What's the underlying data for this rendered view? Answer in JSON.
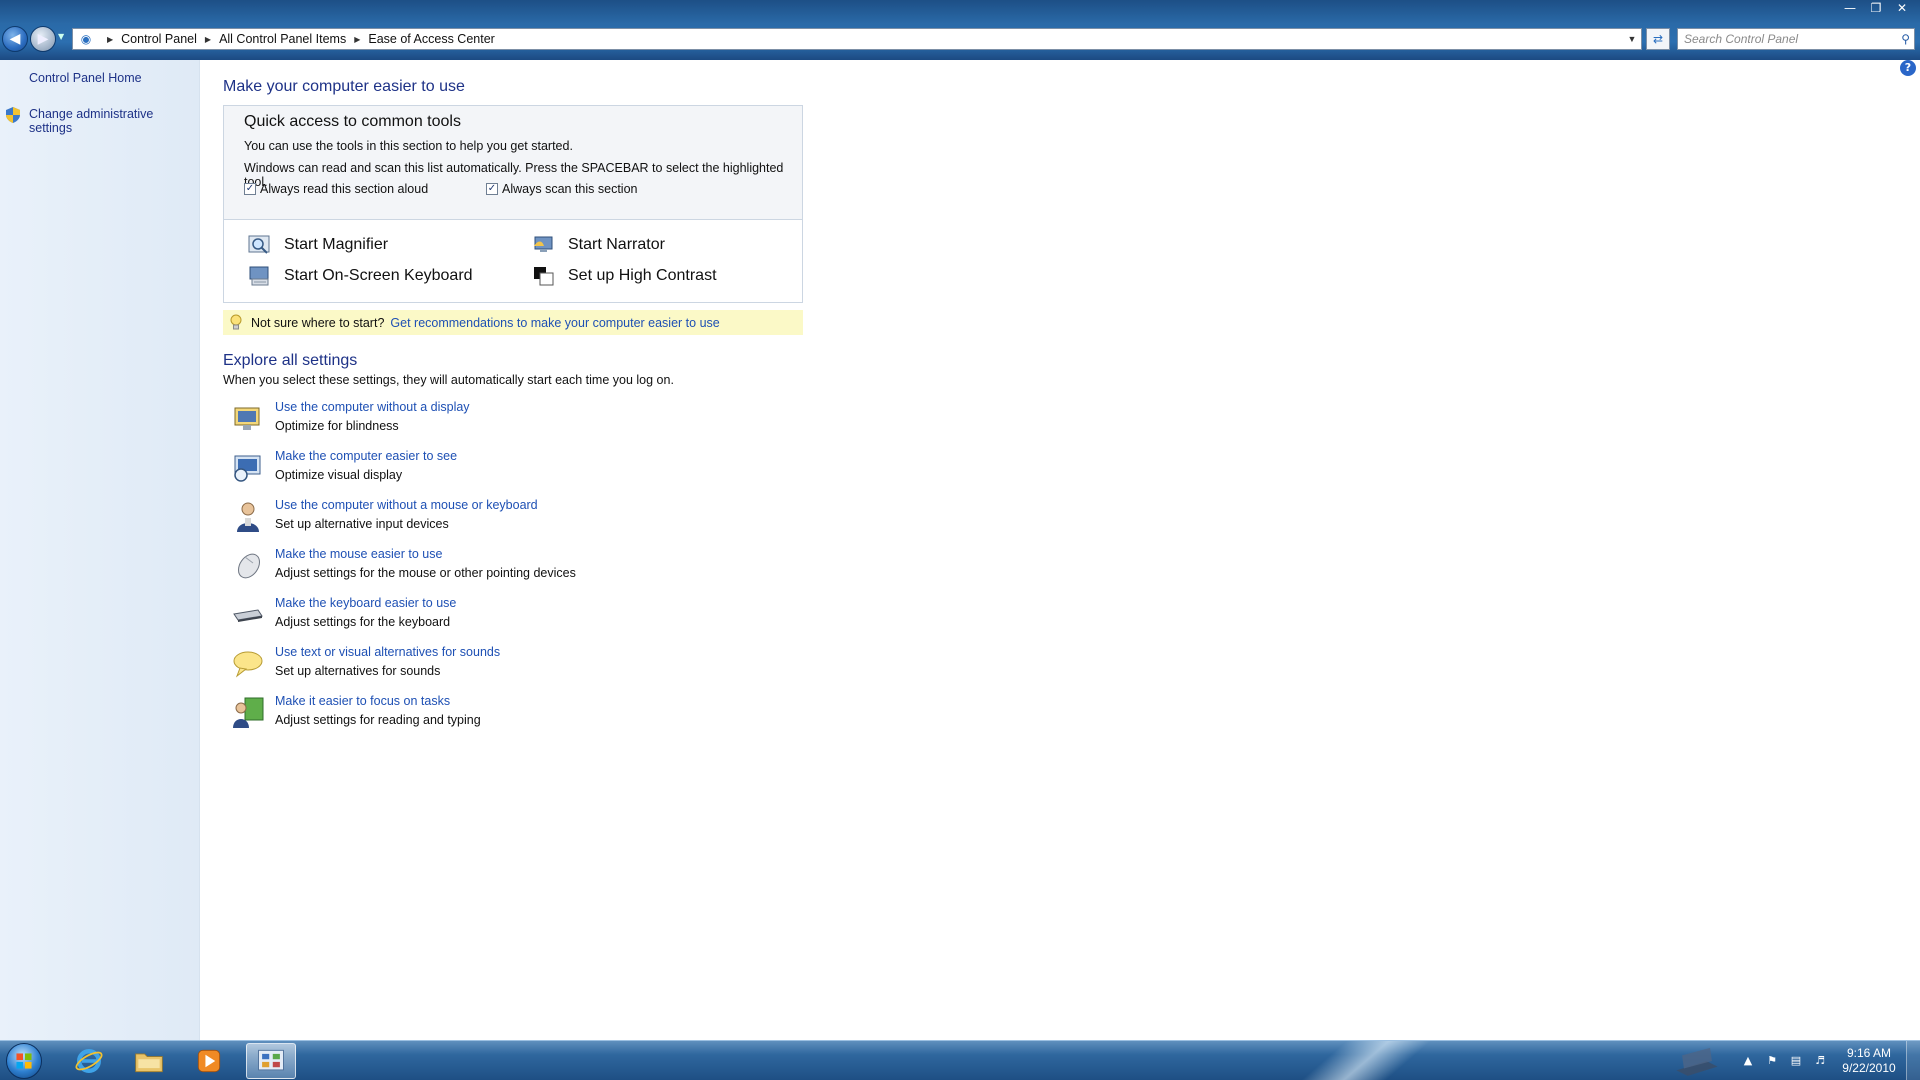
{
  "addressbar": {
    "crumbs": [
      "Control Panel",
      "All Control Panel Items",
      "Ease of Access Center"
    ],
    "search_placeholder": "Search Control Panel"
  },
  "sidebar": {
    "home": "Control Panel Home",
    "admin": "Change administrative settings"
  },
  "main": {
    "title": "Make your computer easier to use",
    "quick": {
      "title": "Quick access to common tools",
      "line1": "You can use the tools in this section to help you get started.",
      "line2": "Windows can read and scan this list automatically.  Press the SPACEBAR to select the highlighted tool.",
      "check_read": "Always read this section aloud",
      "check_scan": "Always scan this section",
      "tools": {
        "magnifier": "Start Magnifier",
        "narrator": "Start Narrator",
        "osk": "Start On-Screen Keyboard",
        "contrast": "Set up High Contrast"
      }
    },
    "tip": {
      "text": "Not sure where to start?",
      "link": "Get recommendations to make your computer easier to use"
    },
    "explore": {
      "title": "Explore all settings",
      "subtitle": "When you select these settings, they will automatically start each time you log on.",
      "items": [
        {
          "link": "Use the computer without a display",
          "desc": "Optimize for blindness",
          "icon": "monitor-icon"
        },
        {
          "link": "Make the computer easier to see",
          "desc": "Optimize visual display",
          "icon": "display-icon"
        },
        {
          "link": "Use the computer without a mouse or keyboard",
          "desc": "Set up alternative input devices",
          "icon": "person-icon"
        },
        {
          "link": "Make the mouse easier to use",
          "desc": "Adjust settings for the mouse or other pointing devices",
          "icon": "mouse-icon"
        },
        {
          "link": "Make the keyboard easier to use",
          "desc": "Adjust settings for the keyboard",
          "icon": "keyboard-icon"
        },
        {
          "link": "Use text or visual alternatives for sounds",
          "desc": "Set up alternatives for sounds",
          "icon": "speech-bubble-icon"
        },
        {
          "link": "Make it easier to focus on tasks",
          "desc": "Adjust settings for reading and typing",
          "icon": "people-icon"
        }
      ]
    }
  },
  "taskbar": {
    "time": "9:16 AM",
    "date": "9/22/2010"
  },
  "colors": {
    "link": "#1e50b4",
    "heading": "#1e3287",
    "tip_bg": "#fbf9c7",
    "sidebar_bg": "#e4eef8"
  }
}
